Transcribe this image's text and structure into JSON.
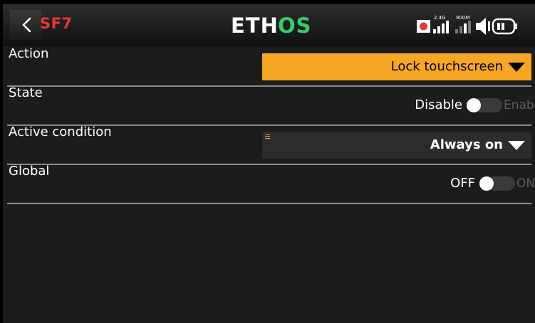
{
  "header": {
    "page_code": "SF7",
    "logo": "ETHOS",
    "status": {
      "signal_1_label": "2.4G",
      "signal_2_label": "900M"
    },
    "icons": [
      "back-chevron-icon",
      "record-icon",
      "signal-bars-icon",
      "speaker-icon",
      "battery-icon"
    ]
  },
  "rows": {
    "action": {
      "label": "Action",
      "value": "Lock touchscreen"
    },
    "state": {
      "label": "State",
      "off_label": "Disable",
      "on_label": "Enable",
      "enabled": false
    },
    "active_condition": {
      "label": "Active condition",
      "value": "Always on"
    },
    "global": {
      "label": "Global",
      "off_label": "OFF",
      "on_label": "ON",
      "enabled": false
    }
  },
  "colors": {
    "accent": "#f5a623",
    "alert_red": "#e53935",
    "logo_green": "#33cc66",
    "background": "#1c1c1c"
  }
}
